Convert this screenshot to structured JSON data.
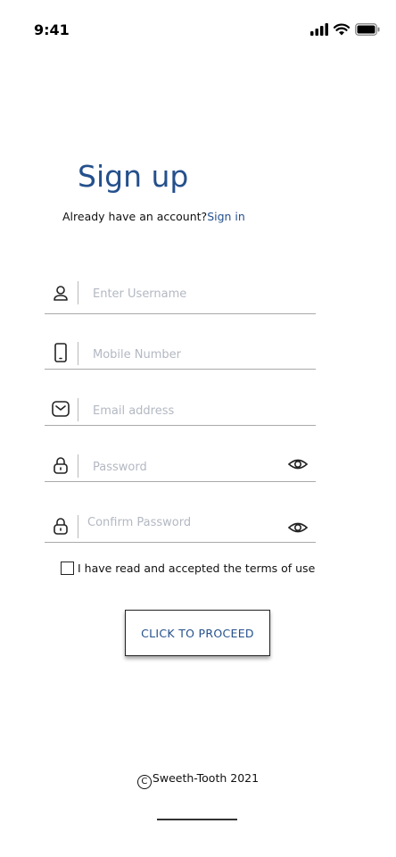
{
  "status_bar": {
    "time": "9:41",
    "icons": [
      "cellular-signal-icon",
      "wifi-icon",
      "battery-icon"
    ]
  },
  "header": {
    "title": "Sign up",
    "account_prompt": "Already have an account?",
    "signin_link": "Sign in"
  },
  "form": {
    "username": {
      "placeholder": "Enter Username",
      "value": "",
      "icon": "user-icon"
    },
    "mobile": {
      "placeholder": "Mobile Number",
      "value": "",
      "icon": "phone-icon"
    },
    "email": {
      "placeholder": "Email address",
      "value": "",
      "icon": "mail-icon"
    },
    "password": {
      "placeholder": "Password",
      "value": "",
      "icon": "lock-icon",
      "toggle_icon": "eye-icon"
    },
    "confirm_password": {
      "placeholder": "Confirm Password",
      "value": "",
      "icon": "lock-icon",
      "toggle_icon": "eye-icon"
    },
    "terms": {
      "label": "I have read and accepted the terms of use",
      "checked": false
    },
    "proceed_label": "CLICK TO PROCEED"
  },
  "footer": {
    "copyright_symbol": "C",
    "text": "Sweeth-Tooth 2021"
  },
  "colors": {
    "accent": "#24508c",
    "placeholder": "#b3b8c2",
    "divider": "#a9a9a9"
  }
}
